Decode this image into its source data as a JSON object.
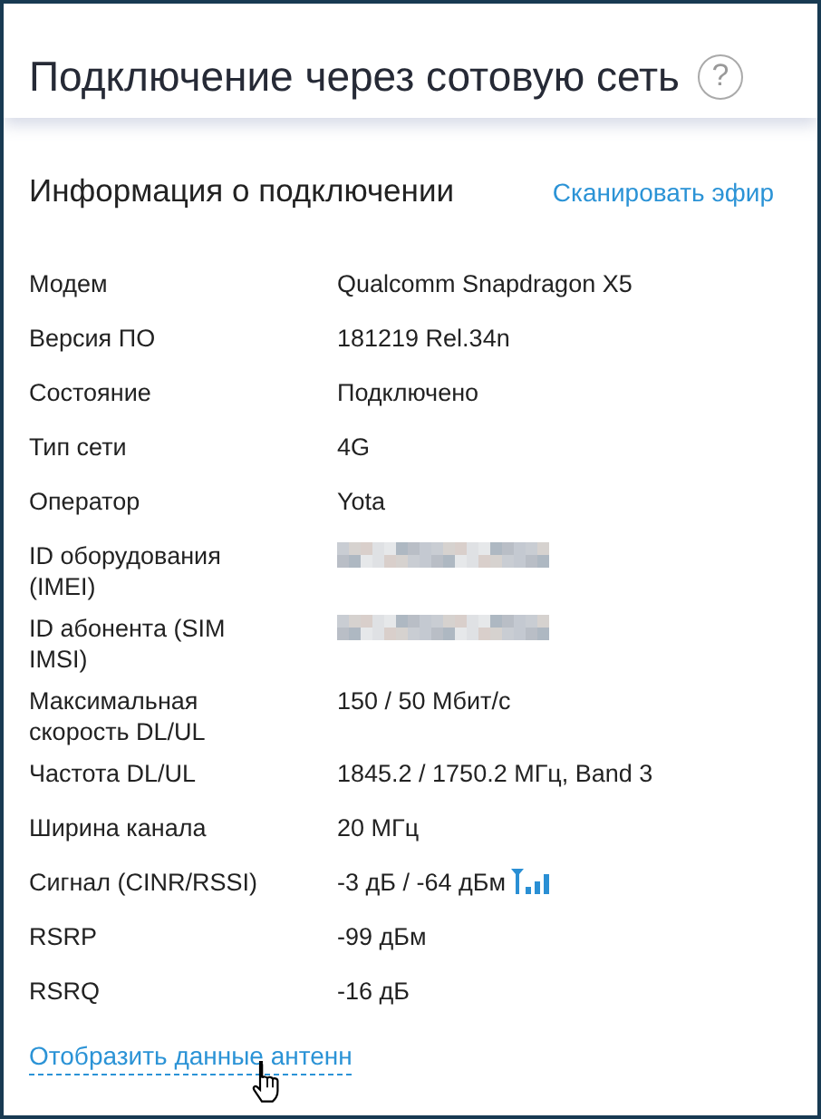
{
  "header": {
    "title": "Подключение через сотовую сеть",
    "help_icon": "?"
  },
  "section": {
    "title": "Информация о подключении",
    "action": "Сканировать эфир"
  },
  "rows": [
    {
      "kind": "text",
      "label": "Модем",
      "value": "Qualcomm Snapdragon X5"
    },
    {
      "kind": "text",
      "label": "Версия ПО",
      "value": "181219 Rel.34n"
    },
    {
      "kind": "text",
      "label": "Состояние",
      "value": "Подключено"
    },
    {
      "kind": "text",
      "label": "Тип сети",
      "value": "4G"
    },
    {
      "kind": "text",
      "label": "Оператор",
      "value": "Yota"
    },
    {
      "kind": "redacted",
      "label": "ID оборудования (IMEI)"
    },
    {
      "kind": "redacted",
      "label": "ID абонента (SIM IMSI)"
    },
    {
      "kind": "text",
      "label": "Максимальная скорость DL/UL",
      "value": "150 / 50 Мбит/с"
    },
    {
      "kind": "text",
      "label": "Частота DL/UL",
      "value": "1845.2 / 1750.2 МГц, Band 3"
    },
    {
      "kind": "text",
      "label": "Ширина канала",
      "value": "20 МГц"
    },
    {
      "kind": "signal",
      "label": "Сигнал (CINR/RSSI)",
      "value": "-3 дБ / -64 дБм"
    },
    {
      "kind": "text",
      "label": "RSRP",
      "value": "-99 дБм"
    },
    {
      "kind": "text",
      "label": "RSRQ",
      "value": "-16 дБ"
    }
  ],
  "footer_link": "Отобразить данные антенн"
}
